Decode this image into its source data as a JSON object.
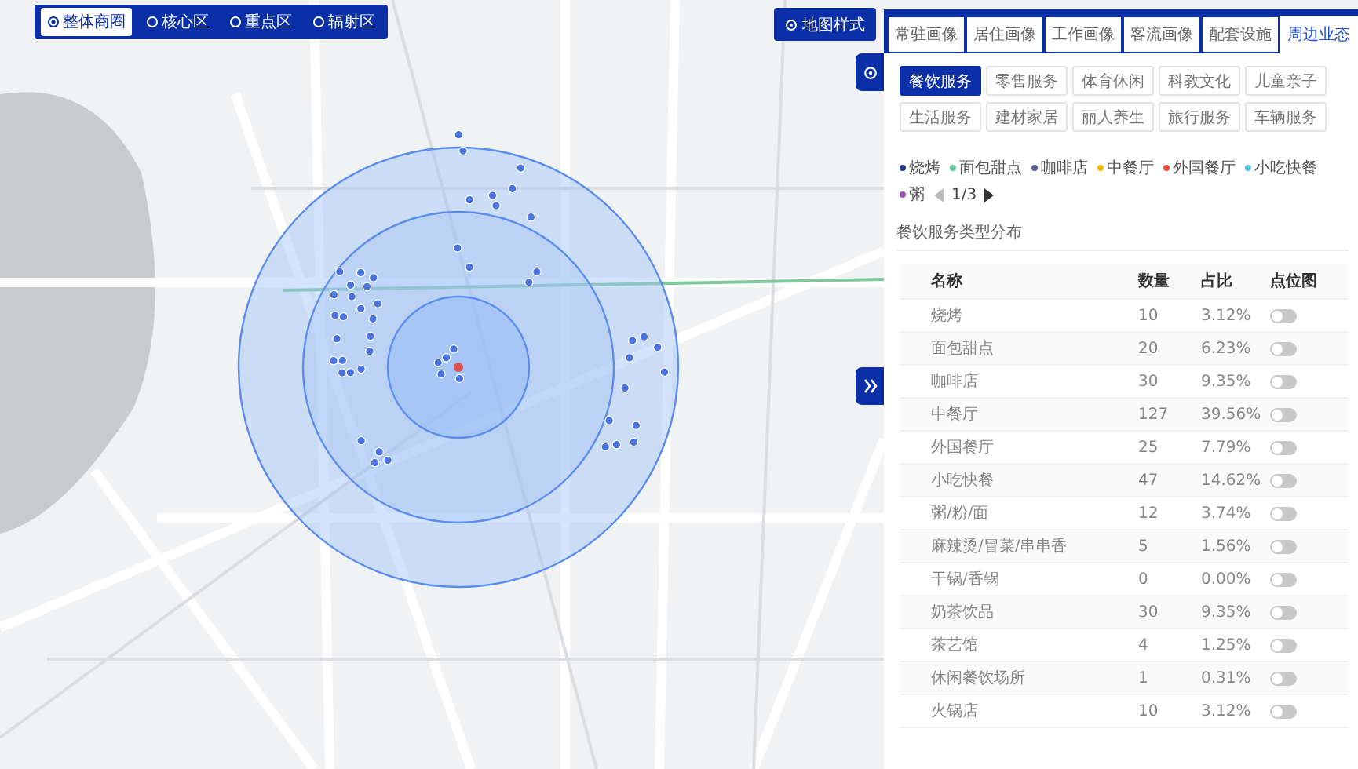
{
  "area_switch": [
    {
      "label": "整体商圈",
      "selected": true
    },
    {
      "label": "核心区",
      "selected": false
    },
    {
      "label": "重点区",
      "selected": false
    },
    {
      "label": "辐射区",
      "selected": false
    }
  ],
  "map_style_button": {
    "label": "地图样式"
  },
  "panel": {
    "tabs": [
      {
        "label": "常驻画像",
        "selected": false
      },
      {
        "label": "居住画像",
        "selected": false
      },
      {
        "label": "工作画像",
        "selected": false
      },
      {
        "label": "客流画像",
        "selected": false
      },
      {
        "label": "配套设施",
        "selected": false
      },
      {
        "label": "周边业态",
        "selected": true
      }
    ],
    "categories": [
      {
        "label": "餐饮服务",
        "selected": true
      },
      {
        "label": "零售服务",
        "selected": false
      },
      {
        "label": "体育休闲",
        "selected": false
      },
      {
        "label": "科教文化",
        "selected": false
      },
      {
        "label": "儿童亲子",
        "selected": false
      },
      {
        "label": "生活服务",
        "selected": false
      },
      {
        "label": "建材家居",
        "selected": false
      },
      {
        "label": "丽人养生",
        "selected": false
      },
      {
        "label": "旅行服务",
        "selected": false
      },
      {
        "label": "车辆服务",
        "selected": false
      }
    ],
    "legend": {
      "items": [
        {
          "label": "烧烤",
          "color": "#1f3a93"
        },
        {
          "label": "面包甜点",
          "color": "#5ecb9e"
        },
        {
          "label": "咖啡店",
          "color": "#5b5f97"
        },
        {
          "label": "中餐厅",
          "color": "#f2b705"
        },
        {
          "label": "外国餐厅",
          "color": "#e84a3c"
        },
        {
          "label": "小吃快餐",
          "color": "#5bc0de"
        },
        {
          "label": "粥",
          "color": "#9b59b6"
        }
      ],
      "page": "1/3"
    },
    "section_title": "餐饮服务类型分布",
    "table": {
      "columns": [
        "名称",
        "数量",
        "占比",
        "点位图"
      ],
      "rows": [
        {
          "name": "烧烤",
          "count": "10",
          "share": "3.12%",
          "on": false
        },
        {
          "name": "面包甜点",
          "count": "20",
          "share": "6.23%",
          "on": false
        },
        {
          "name": "咖啡店",
          "count": "30",
          "share": "9.35%",
          "on": false
        },
        {
          "name": "中餐厅",
          "count": "127",
          "share": "39.56%",
          "on": false
        },
        {
          "name": "外国餐厅",
          "count": "25",
          "share": "7.79%",
          "on": false
        },
        {
          "name": "小吃快餐",
          "count": "47",
          "share": "14.62%",
          "on": false
        },
        {
          "name": "粥/粉/面",
          "count": "12",
          "share": "3.74%",
          "on": false
        },
        {
          "name": "麻辣烫/冒菜/串串香",
          "count": "5",
          "share": "1.56%",
          "on": false
        },
        {
          "name": "干锅/香锅",
          "count": "0",
          "share": "0.00%",
          "on": false
        },
        {
          "name": "奶茶饮品",
          "count": "30",
          "share": "9.35%",
          "on": false
        },
        {
          "name": "茶艺馆",
          "count": "4",
          "share": "1.25%",
          "on": false
        },
        {
          "name": "休闲餐饮场所",
          "count": "1",
          "share": "0.31%",
          "on": false
        },
        {
          "name": "火锅店",
          "count": "10",
          "share": "3.12%",
          "on": false
        }
      ]
    }
  }
}
